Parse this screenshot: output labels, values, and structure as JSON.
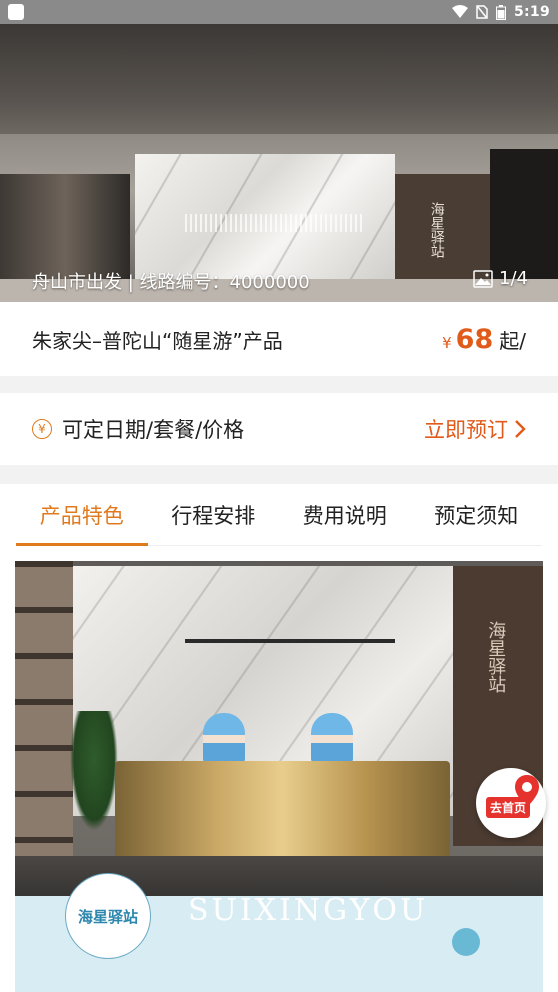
{
  "status_bar": {
    "time": "5:19"
  },
  "hero": {
    "caption": "舟山市出发 | 线路编号：4000000",
    "counter": "1/4",
    "sign_text": "海星驿站"
  },
  "product": {
    "title": "朱家尖–普陀山“随星游”产品",
    "currency": "¥",
    "price": "68",
    "price_suffix": "起/"
  },
  "booking": {
    "icon_glyph": "¥",
    "label": "可定日期/套餐/价格",
    "action": "立即预订"
  },
  "tabs": [
    {
      "label": "产品特色",
      "active": true
    },
    {
      "label": "行程安排",
      "active": false
    },
    {
      "label": "费用说明",
      "active": false
    },
    {
      "label": "预定须知",
      "active": false
    }
  ],
  "photo": {
    "sign_text": "海星驿站"
  },
  "brand": {
    "logo_text": "海星驿站",
    "wordmark": "SUIXINGYOU"
  },
  "home_fab": {
    "label": "去首页"
  },
  "colors": {
    "accent": "#e07a1f",
    "price": "#e05a1a",
    "brand_blue": "#2d86ad"
  }
}
